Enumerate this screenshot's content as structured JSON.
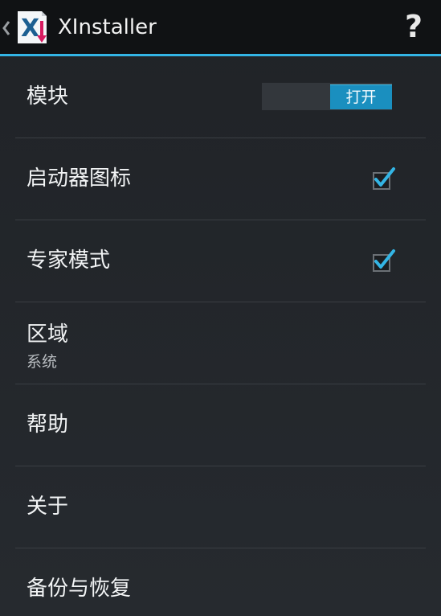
{
  "actionbar": {
    "title": "XInstaller",
    "app_icon_letter": "X",
    "help_label": "?",
    "accent": "#33b5e5"
  },
  "settings": {
    "module": {
      "title": "模块",
      "switch_label": "打开",
      "on": true
    },
    "launcher_icon": {
      "title": "启动器图标",
      "checked": true
    },
    "expert_mode": {
      "title": "专家模式",
      "checked": true
    },
    "locale": {
      "title": "区域",
      "summary": "系统"
    },
    "help": {
      "title": "帮助"
    },
    "about": {
      "title": "关于"
    },
    "backup": {
      "title": "备份与恢复"
    }
  },
  "icons": {
    "up": "chevron-left-icon",
    "app": "xinstaller-app-icon",
    "help": "question-mark-icon",
    "check": "checkmark-icon"
  },
  "colors": {
    "background": "#23262b",
    "actionbar": "#101214",
    "switch_on": "#1a8fbf",
    "checkmark": "#33b5e5"
  }
}
